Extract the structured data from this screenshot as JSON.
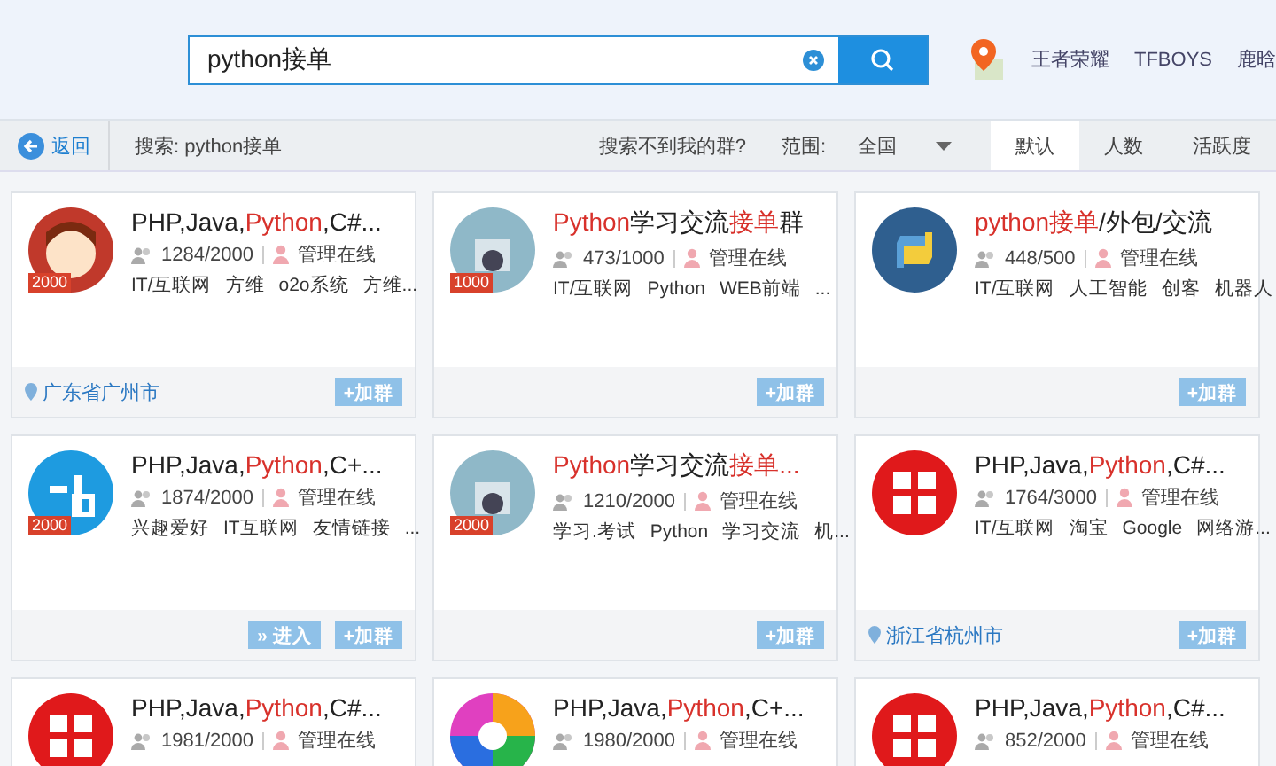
{
  "search": {
    "value": "python接单"
  },
  "hot_links": [
    "王者荣耀",
    "TFBOYS",
    "鹿晗"
  ],
  "toolbar": {
    "back": "返回",
    "query": "搜索: python接单",
    "help": "搜索不到我的群?",
    "scope_label": "范围:",
    "scope_value": "全国"
  },
  "sort_tabs": [
    {
      "label": "默认",
      "selected": true
    },
    {
      "label": "人数",
      "selected": false
    },
    {
      "label": "活跃度",
      "selected": false
    }
  ],
  "groups": [
    {
      "avatar": {
        "kind": "cartoon"
      },
      "badge": "2000",
      "title": [
        {
          "text": "PHP,Java,",
          "highlight": false
        },
        {
          "text": "Python",
          "highlight": true
        },
        {
          "text": ",C#...",
          "highlight": false
        }
      ],
      "members": "1284/2000",
      "admin": "管理在线",
      "tags": [
        "IT/互联网",
        "方维",
        "o2o系统",
        "方维..."
      ],
      "location": "广东省广州市",
      "buttons": [
        "+加群"
      ]
    },
    {
      "avatar": {
        "kind": "photo"
      },
      "badge": "1000",
      "title": [
        {
          "text": "Python",
          "highlight": true
        },
        {
          "text": "学习交流",
          "highlight": false
        },
        {
          "text": "接单",
          "highlight": true
        },
        {
          "text": "群",
          "highlight": false
        }
      ],
      "members": "473/1000",
      "admin": "管理在线",
      "tags": [
        "IT/互联网",
        "Python",
        "WEB前端",
        "..."
      ],
      "buttons": [
        "+加群"
      ]
    },
    {
      "avatar": {
        "kind": "python"
      },
      "title": [
        {
          "text": "python接单",
          "highlight": true
        },
        {
          "text": "/外包/交流",
          "highlight": false
        }
      ],
      "members": "448/500",
      "admin": "管理在线",
      "tags": [
        "IT/互联网",
        "人工智能",
        "创客",
        "机器人"
      ],
      "buttons": [
        "+加群"
      ]
    },
    {
      "avatar": {
        "kind": "site"
      },
      "badge": "2000",
      "title": [
        {
          "text": "PHP,Java,",
          "highlight": false
        },
        {
          "text": "Python",
          "highlight": true
        },
        {
          "text": ",C+...",
          "highlight": false
        }
      ],
      "members": "1874/2000",
      "admin": "管理在线",
      "tags": [
        "兴趣爱好",
        "IT互联网",
        "友情链接",
        "..."
      ],
      "buttons": [
        "» 进入",
        "+加群"
      ]
    },
    {
      "avatar": {
        "kind": "photo"
      },
      "badge": "2000",
      "title": [
        {
          "text": "Python",
          "highlight": true
        },
        {
          "text": "学习交流",
          "highlight": false
        },
        {
          "text": "接单...",
          "highlight": true
        }
      ],
      "members": "1210/2000",
      "admin": "管理在线",
      "tags": [
        "学习.考试",
        "Python",
        "学习交流",
        "机..."
      ],
      "buttons": [
        "+加群"
      ]
    },
    {
      "avatar": {
        "kind": "red-logo"
      },
      "title": [
        {
          "text": "PHP,Java,",
          "highlight": false
        },
        {
          "text": "Python",
          "highlight": true
        },
        {
          "text": ",C#...",
          "highlight": false
        }
      ],
      "members": "1764/3000",
      "admin": "管理在线",
      "tags": [
        "IT/互联网",
        "淘宝",
        "Google",
        "网络游..."
      ],
      "location": "浙江省杭州市",
      "buttons": [
        "+加群"
      ]
    },
    {
      "avatar": {
        "kind": "red-logo"
      },
      "title": [
        {
          "text": "PHP,Java,",
          "highlight": false
        },
        {
          "text": "Python",
          "highlight": true
        },
        {
          "text": ",C#...",
          "highlight": false
        }
      ],
      "members": "1981/2000",
      "admin": "管理在线"
    },
    {
      "avatar": {
        "kind": "rainbow"
      },
      "title": [
        {
          "text": "PHP,Java,",
          "highlight": false
        },
        {
          "text": "Python",
          "highlight": true
        },
        {
          "text": ",C+...",
          "highlight": false
        }
      ],
      "members": "1980/2000",
      "admin": "管理在线"
    },
    {
      "avatar": {
        "kind": "red-logo"
      },
      "title": [
        {
          "text": "PHP,Java,",
          "highlight": false
        },
        {
          "text": "Python",
          "highlight": true
        },
        {
          "text": ",C#...",
          "highlight": false
        }
      ],
      "members": "852/2000",
      "admin": "管理在线"
    }
  ]
}
